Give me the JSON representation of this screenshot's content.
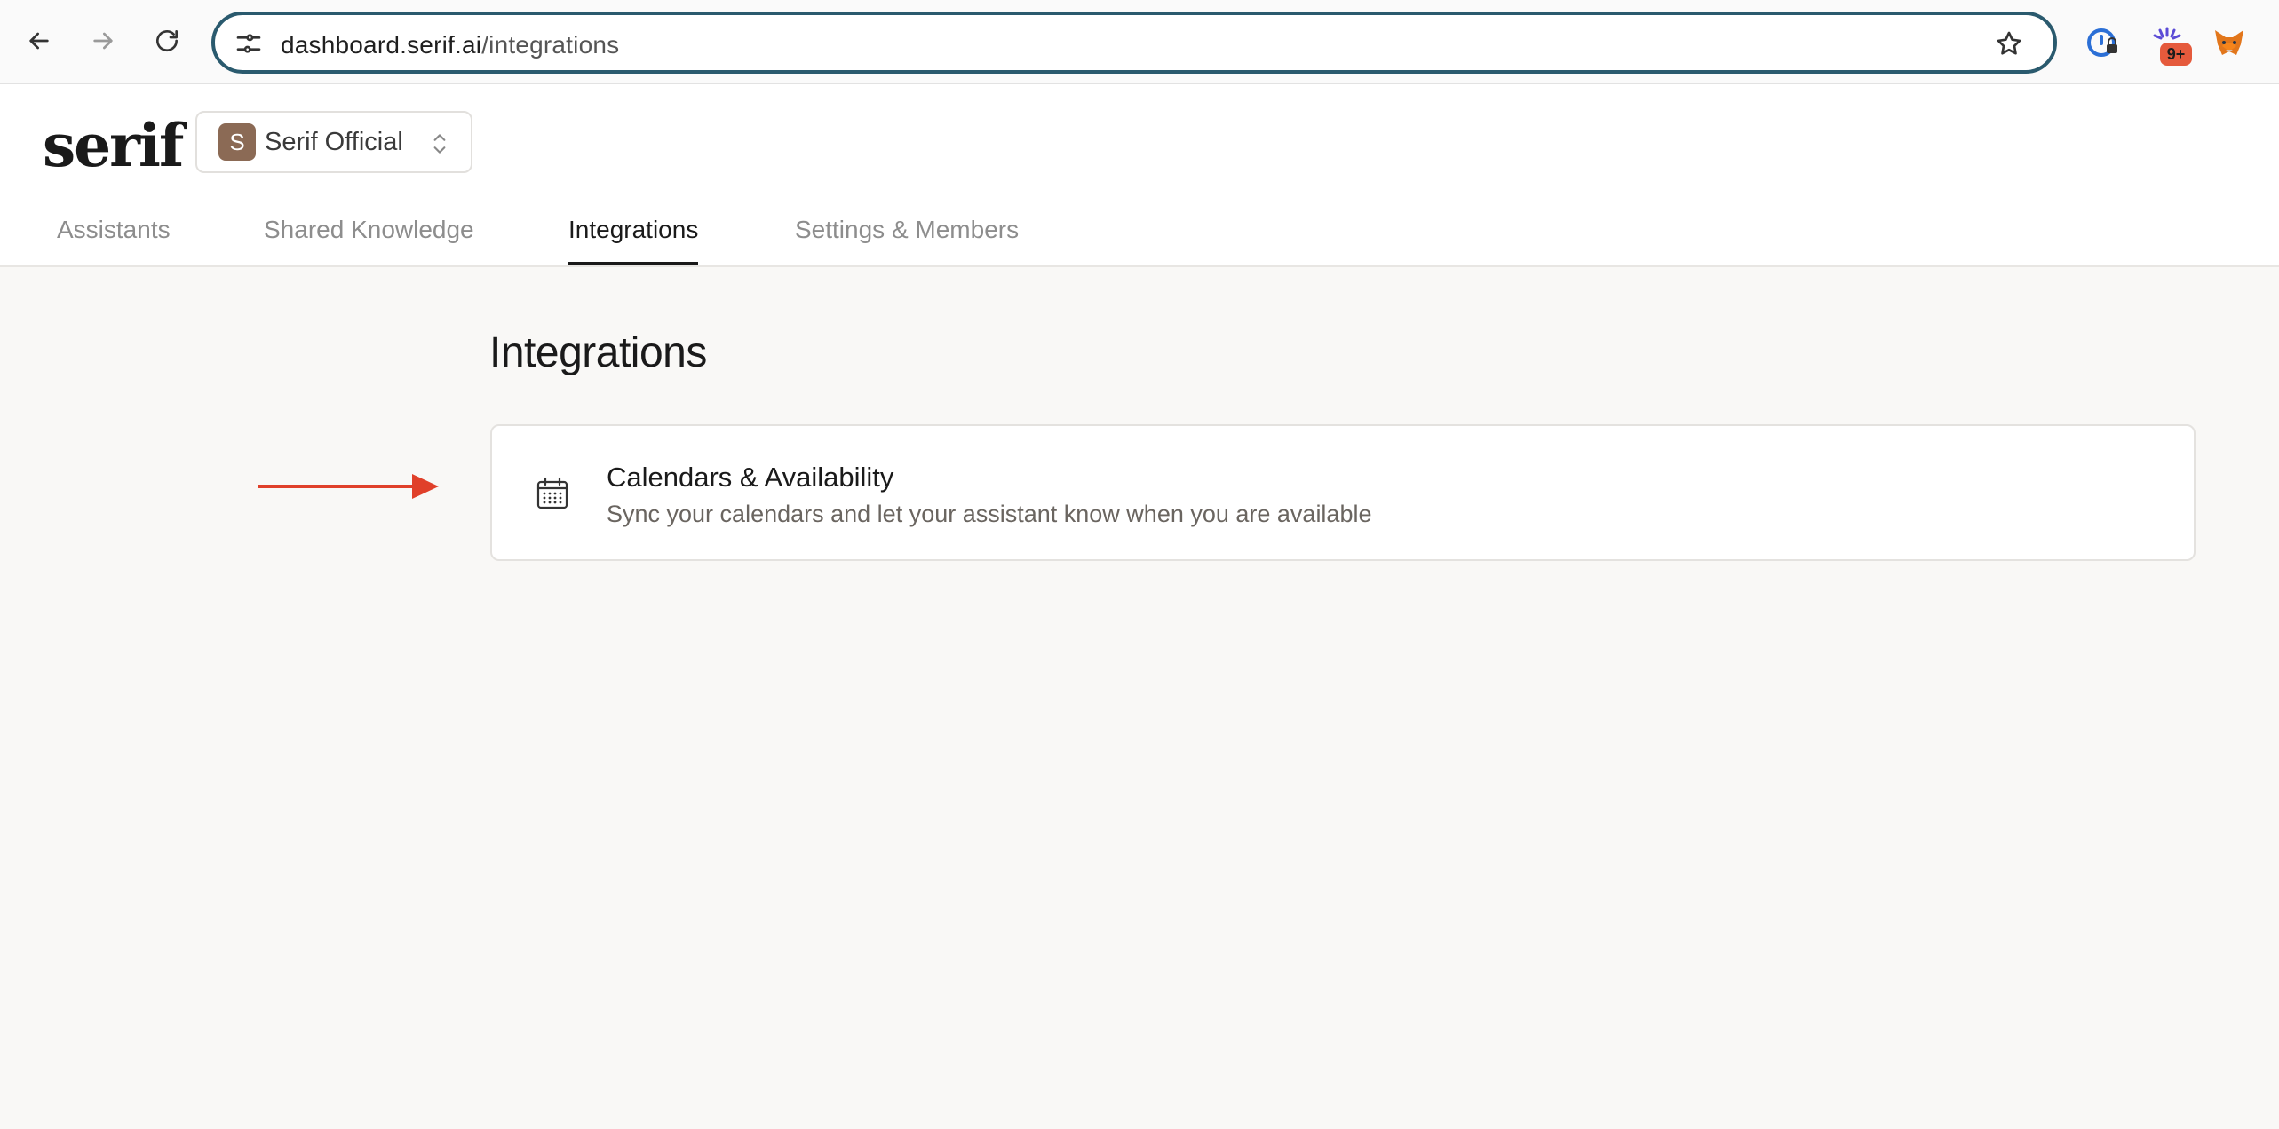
{
  "browser": {
    "url_host": "dashboard.serif.ai",
    "url_path": "/integrations",
    "extension_badge": "9+"
  },
  "app": {
    "logo": "serif",
    "org": {
      "avatar_letter": "S",
      "name": "Serif Official"
    },
    "tabs": [
      {
        "label": "Assistants"
      },
      {
        "label": "Shared Knowledge"
      },
      {
        "label": "Integrations",
        "active": true
      },
      {
        "label": "Settings & Members"
      }
    ]
  },
  "main": {
    "title": "Integrations",
    "integrations": [
      {
        "icon": "calendar-icon",
        "title": "Calendars & Availability",
        "description": "Sync your calendars and let your assistant know when you are available"
      }
    ]
  },
  "colors": {
    "accent": "#2a5a6e",
    "annotation_arrow": "#e0402a",
    "org_avatar": "#8b6a55",
    "page_bg": "#f9f8f6"
  }
}
